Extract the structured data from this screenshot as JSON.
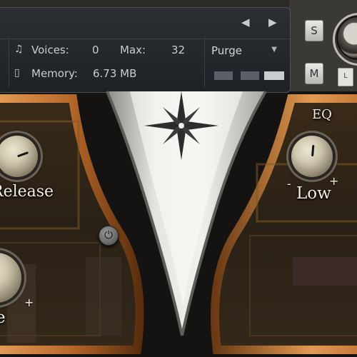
{
  "header": {
    "prev_icon": "arrow-left-icon",
    "next_icon": "arrow-right-icon",
    "voices_icon": "voices-icon",
    "voices_label": "Voices:",
    "voices_value": "0",
    "max_label": "Max:",
    "max_value": "32",
    "memory_icon": "memory-icon",
    "memory_label": "Memory:",
    "memory_value": "6.73 MB",
    "purge_value": "Purge"
  },
  "side_buttons": {
    "solo_label": "S",
    "mute_label": "M",
    "l_label": "L"
  },
  "left_panel": {
    "release_label": "Release",
    "lower_label": "e",
    "lower_plus": "+"
  },
  "right_panel": {
    "eq_title": "EQ",
    "eq_low_label": "Low",
    "eq_minus": "-",
    "eq_plus": "+"
  },
  "colors": {
    "copper": "#b8682a",
    "panel_dark": "#2a2d31",
    "text": "#c8cdd1",
    "ornament": "#d8d6d2"
  }
}
